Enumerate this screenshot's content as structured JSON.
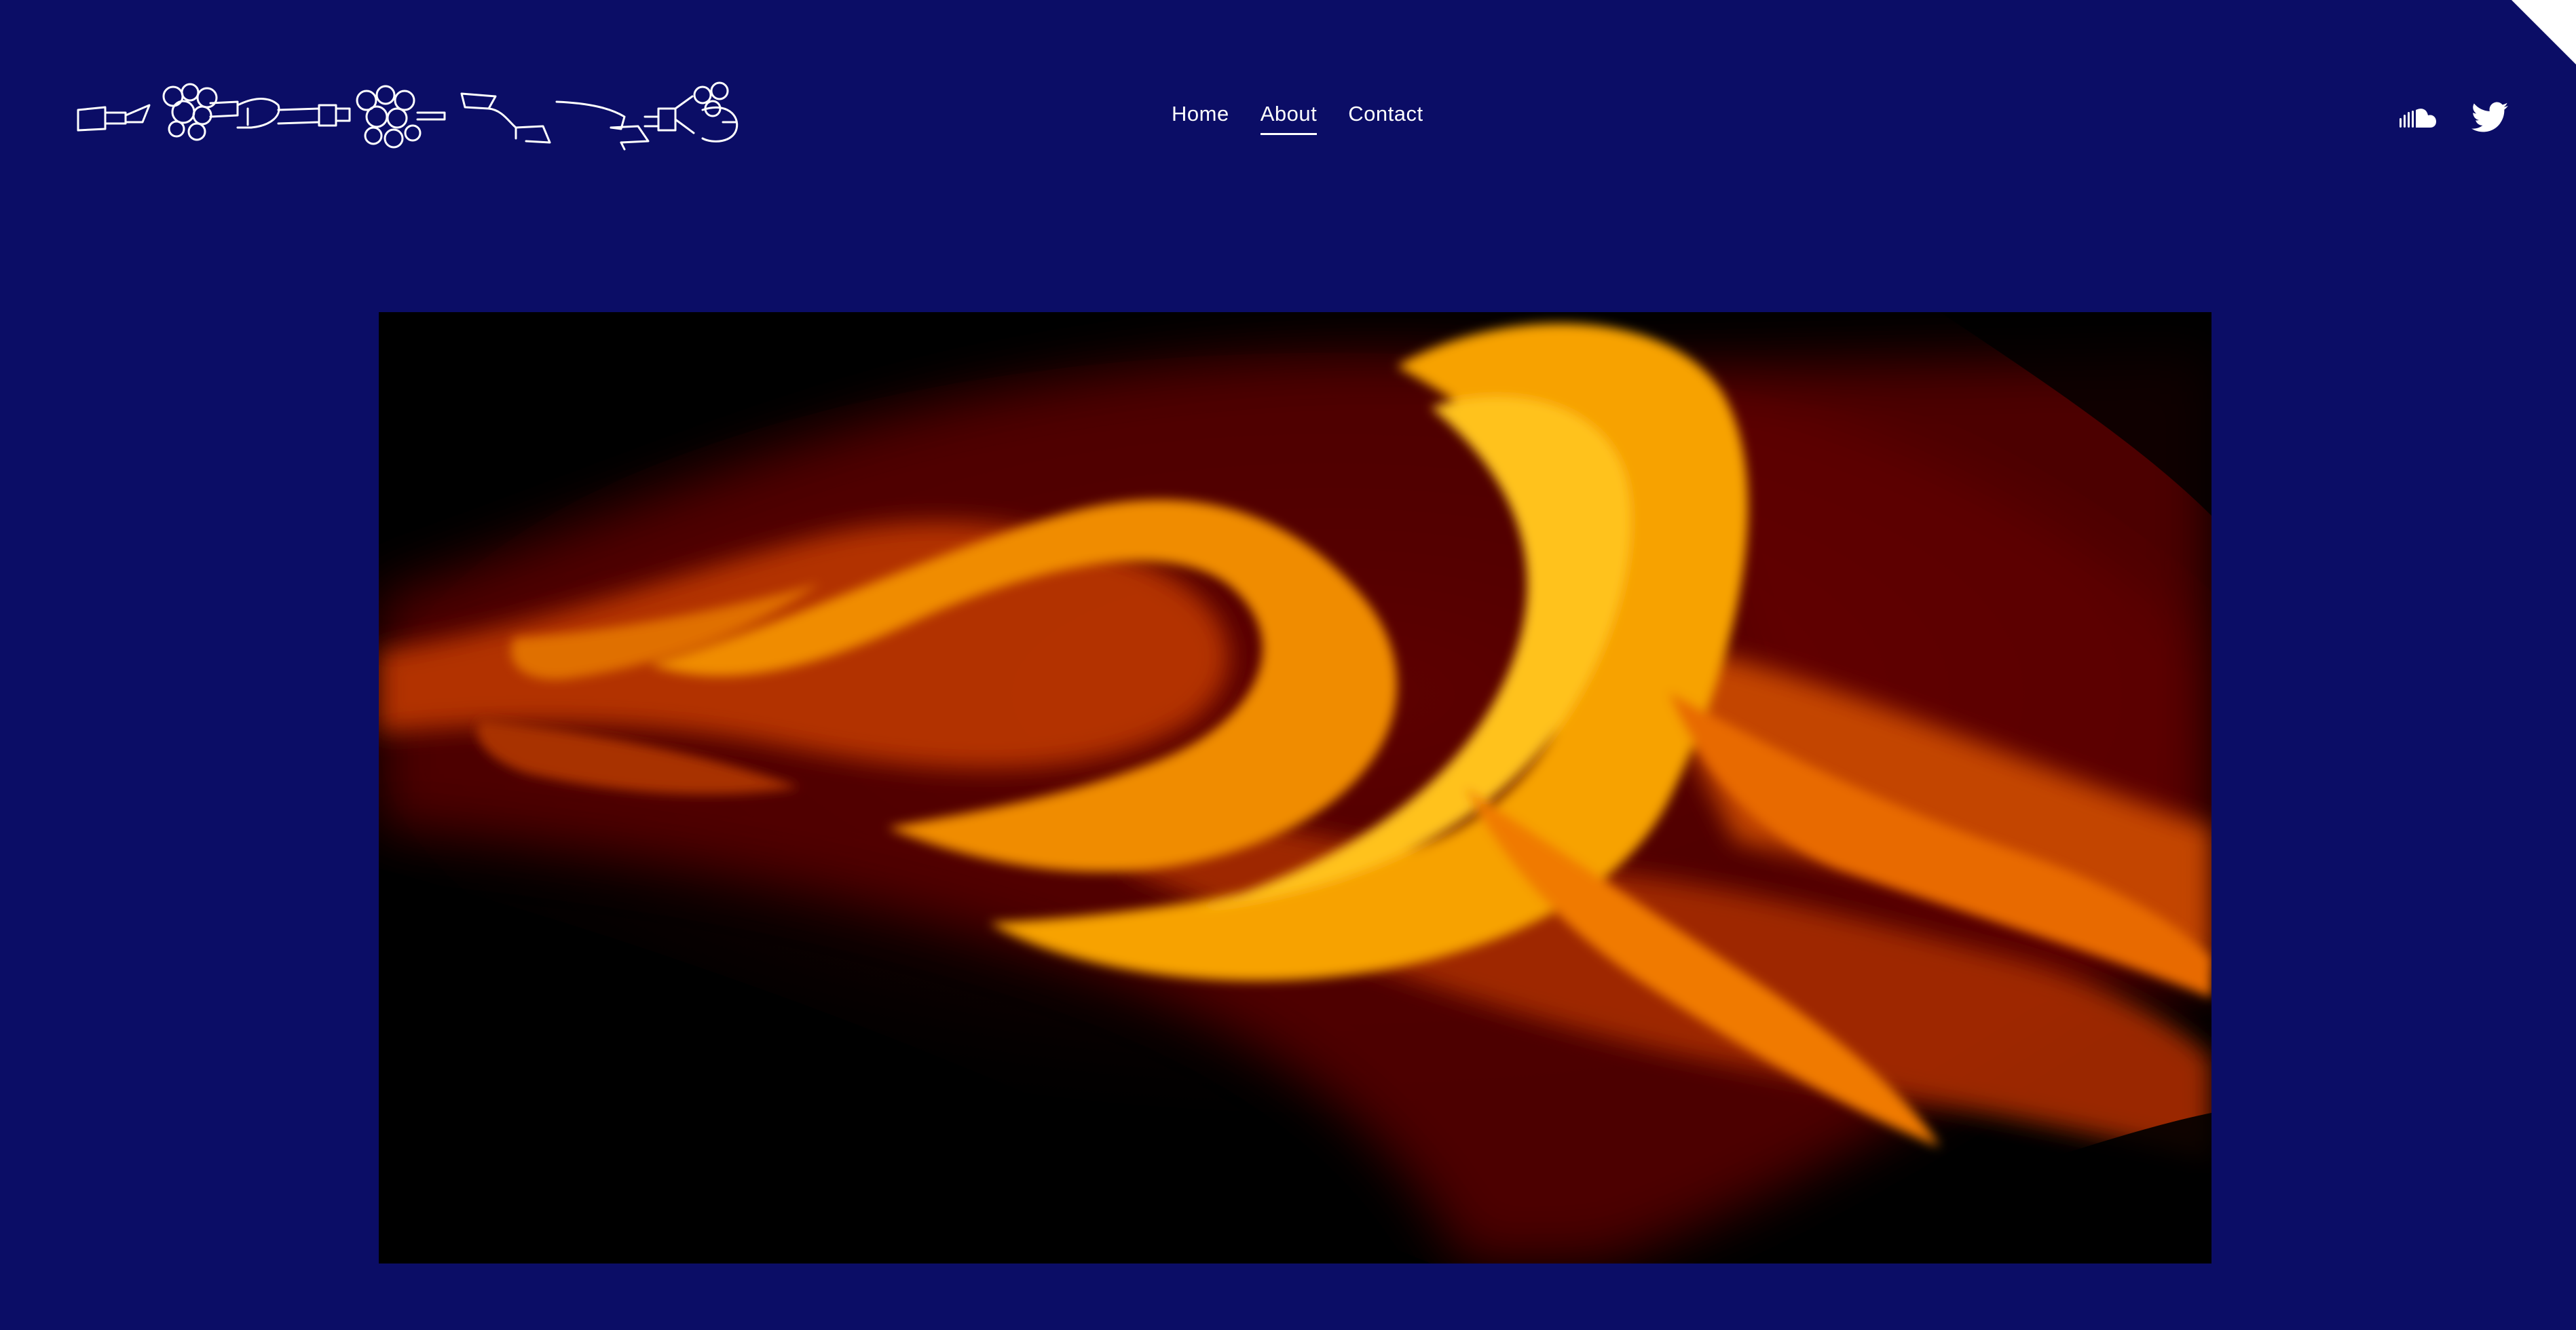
{
  "site": {
    "background_color": "#0b0d66",
    "logo": {
      "kind": "decorative-ribbon-lettering",
      "color": "#ffffff"
    }
  },
  "nav": {
    "items": [
      {
        "label": "Home",
        "active": false
      },
      {
        "label": "About",
        "active": true
      },
      {
        "label": "Contact",
        "active": false
      }
    ]
  },
  "social": {
    "icons": [
      "soundcloud-icon",
      "twitter-icon"
    ],
    "color": "#ffffff"
  },
  "hero": {
    "image_kind": "flame",
    "colors": [
      "#000000",
      "#8b0a00",
      "#e25a00",
      "#f7a400"
    ]
  }
}
